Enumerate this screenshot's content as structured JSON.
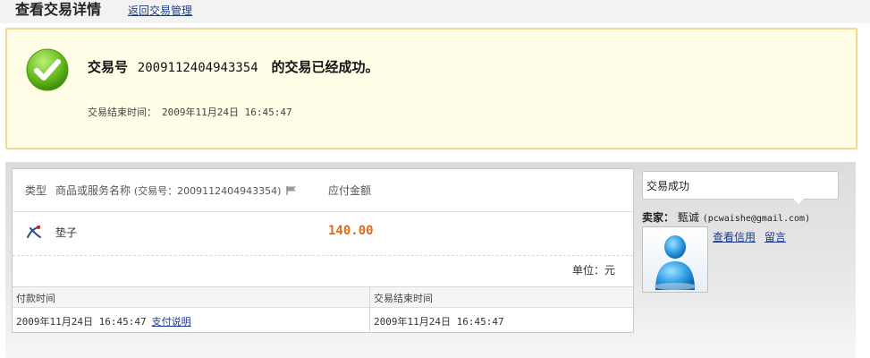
{
  "header": {
    "title": "查看交易详情",
    "back_link": "返回交易管理"
  },
  "notice": {
    "icon": "check-circle-icon",
    "prefix": "交易号",
    "trade_no": "2009112404943354",
    "suffix": "的交易已经成功。",
    "end_time_label": "交易结束时间：",
    "end_time": "2009年11月24日 16:45:47"
  },
  "order": {
    "col_type": "类型",
    "col_name": "商品或服务名称",
    "col_name_extra": "(交易号：2009112404943354)",
    "col_amount": "应付金额",
    "item": {
      "icon": "item-type-icon",
      "name": "垫子",
      "price": "140.00"
    },
    "unit": "单位：元",
    "pay_time_label": "付款时间",
    "end_time_label": "交易结束时间",
    "pay_time": "2009年11月24日 16:45:47",
    "pay_link": "支付说明",
    "end_time": "2009年11月24日 16:45:47"
  },
  "side": {
    "status": "交易成功",
    "seller_label": "卖家：",
    "seller_name": "甄诚",
    "seller_email": "(pcwaishe@gmail.com)",
    "link_credit": "查看信用",
    "link_message": "留言"
  },
  "colors": {
    "price": "#e06a1b",
    "link": "#1a3d8f",
    "notice_bg": "#fffde6",
    "notice_border": "#f4d89a"
  }
}
